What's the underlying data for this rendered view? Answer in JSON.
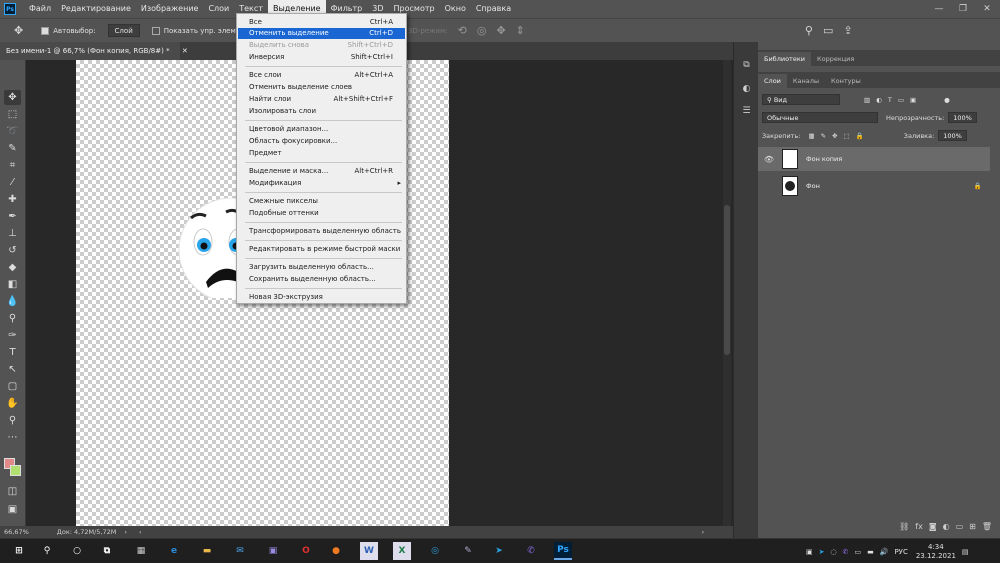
{
  "app": {
    "logo": "Ps"
  },
  "menubar": {
    "items": [
      "Файл",
      "Редактирование",
      "Изображение",
      "Слои",
      "Текст",
      "Выделение",
      "Фильтр",
      "3D",
      "Просмотр",
      "Окно",
      "Справка"
    ],
    "active_index": 5,
    "window_controls": [
      "minimize-icon",
      "maximize-icon",
      "close-icon"
    ]
  },
  "options": {
    "autoselect_label": "Автовыбор:",
    "autoselect_value": "Слой",
    "show_controls_label": "Показать упр. элем.",
    "mode_3d": "3D-режим:"
  },
  "document": {
    "tab_title": "Без имени-1 @ 66,7% (Фон копия, RGB/8#) *"
  },
  "status": {
    "zoom": "66,67%",
    "doc_info": "Док: 4,72M/5,72M"
  },
  "dropdown": {
    "items": [
      {
        "label": "Все",
        "shortcut": "Ctrl+A"
      },
      {
        "label": "Отменить выделение",
        "shortcut": "Ctrl+D",
        "highlighted": true
      },
      {
        "label": "Выделить снова",
        "shortcut": "Shift+Ctrl+D",
        "disabled": true
      },
      {
        "label": "Инверсия",
        "shortcut": "Shift+Ctrl+I"
      },
      {
        "label": "Все слои",
        "shortcut": "Alt+Ctrl+A"
      },
      {
        "label": "Отменить выделение слоев",
        "shortcut": ""
      },
      {
        "label": "Найти слои",
        "shortcut": "Alt+Shift+Ctrl+F"
      },
      {
        "label": "Изолировать слои",
        "shortcut": ""
      },
      {
        "label": "Цветовой диапазон...",
        "shortcut": ""
      },
      {
        "label": "Область фокусировки...",
        "shortcut": ""
      },
      {
        "label": "Предмет",
        "shortcut": ""
      },
      {
        "label": "Выделение и маска...",
        "shortcut": "Alt+Ctrl+R"
      },
      {
        "label": "Модификация",
        "shortcut": "",
        "submenu": true
      },
      {
        "label": "Смежные пикселы",
        "shortcut": ""
      },
      {
        "label": "Подобные оттенки",
        "shortcut": ""
      },
      {
        "label": "Трансформировать выделенную область",
        "shortcut": ""
      },
      {
        "label": "Редактировать в режиме быстрой маски",
        "shortcut": ""
      },
      {
        "label": "Загрузить выделенную область...",
        "shortcut": ""
      },
      {
        "label": "Сохранить выделенную область...",
        "shortcut": ""
      },
      {
        "label": "Новая 3D-экструзия",
        "shortcut": ""
      }
    ]
  },
  "panels": {
    "top_tabs": [
      "Библиотеки",
      "Коррекция"
    ],
    "layer_tabs": [
      "Слои",
      "Каналы",
      "Контуры"
    ],
    "filter_kind": "Вид",
    "blend_mode": "Обычные",
    "opacity_label": "Непрозрачность:",
    "opacity_value": "100%",
    "lock_label": "Закрепить:",
    "fill_label": "Заливка:",
    "fill_value": "100%",
    "layers": [
      {
        "name": "Фон копия",
        "selected": true,
        "visible": true
      },
      {
        "name": "Фон",
        "selected": false,
        "visible": false,
        "locked": true
      }
    ]
  },
  "taskbar": {
    "time": "4:34",
    "date": "23.12.2021",
    "lang": "РУС"
  },
  "colors": {
    "accent": "#1a66d2",
    "foreground_swatch": "#e08a8a",
    "background_swatch": "#b0e070",
    "eye_iris": "#2aa5ea"
  }
}
